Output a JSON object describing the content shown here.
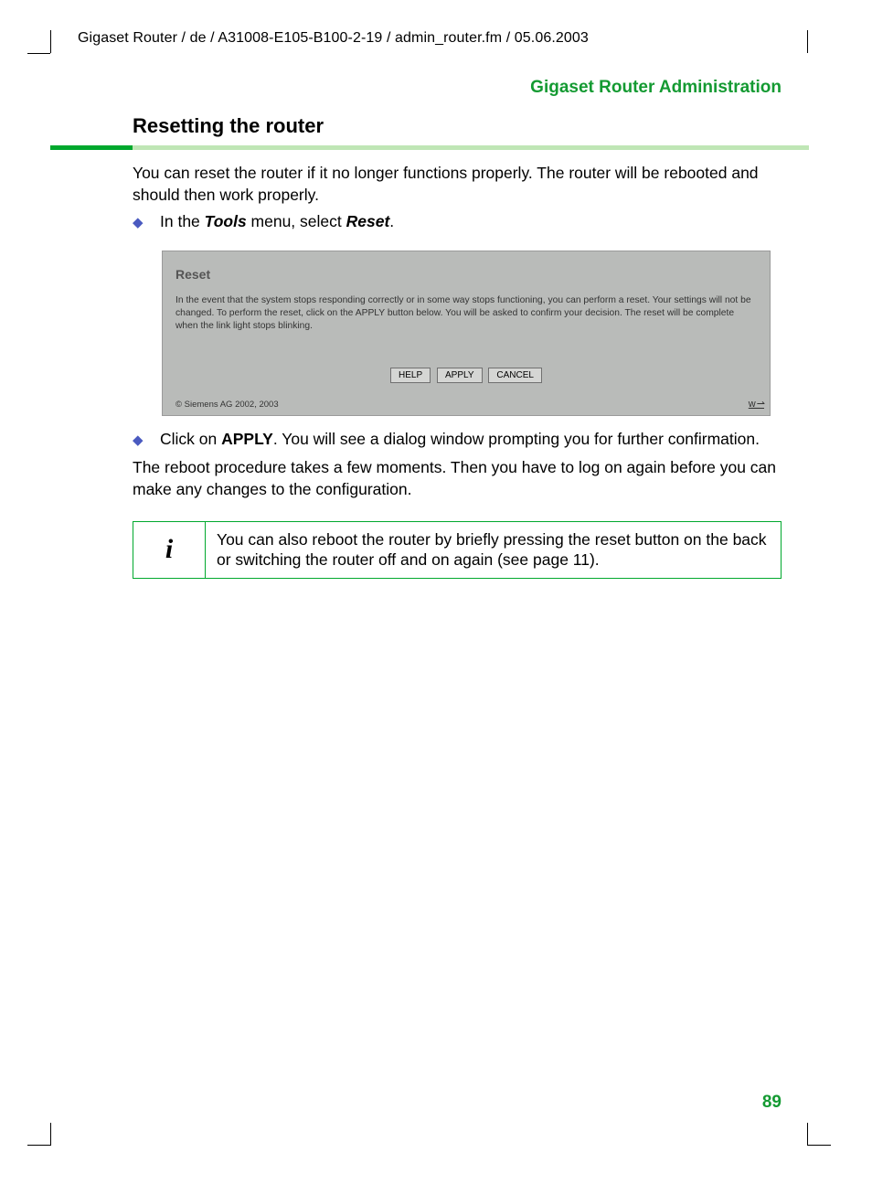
{
  "header_path": "Gigaset Router / de / A31008-E105-B100-2-19 / admin_router.fm / 05.06.2003",
  "section_title": "Gigaset Router Administration",
  "heading": "Resetting the router",
  "intro": "You can reset the router if it no longer functions properly. The router will be rebooted and should then work properly.",
  "bullet1_a": "In the ",
  "bullet1_b": "Tools",
  "bullet1_c": " menu, select ",
  "bullet1_d": "Reset",
  "bullet1_e": ".",
  "shot": {
    "title": "Reset",
    "body": "In the event that the system stops responding correctly or in some way stops functioning, you can perform a reset. Your settings will not be changed. To perform the reset, click on the APPLY button below. You will be asked to confirm your decision. The reset will be complete when the link light stops blinking.",
    "help": "HELP",
    "apply": "APPLY",
    "cancel": "CANCEL",
    "copyright": "© Siemens AG 2002, 2003"
  },
  "bullet2_a": "Click on ",
  "bullet2_b": "APPLY",
  "bullet2_c": ". You will see a dialog window prompting you for further confirmation.",
  "reboot_note": "The reboot procedure takes a few moments. Then you have to log on again before you can make any changes to the configuration.",
  "info_i": "i",
  "info_text": "You can also reboot the router by briefly pressing the reset button on the back or switching the router off and on again (see page 11).",
  "page_number": "89"
}
